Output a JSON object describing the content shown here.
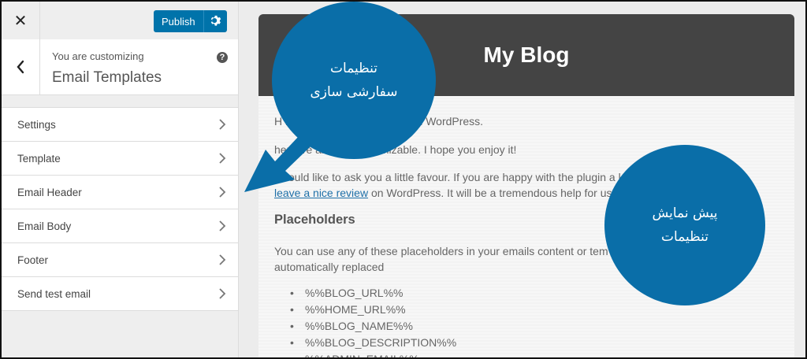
{
  "customizer": {
    "close_glyph": "✕",
    "publish_label": "Publish",
    "info_subtitle": "You are customizing",
    "info_title": "Email Templates",
    "help_glyph": "?",
    "menu": [
      {
        "label": "Settings"
      },
      {
        "label": "Template"
      },
      {
        "label": "Email Header"
      },
      {
        "label": "Email Body"
      },
      {
        "label": "Footer"
      },
      {
        "label": "Send test email"
      }
    ]
  },
  "preview": {
    "blog_title": "My Blog",
    "line1": "H                                   ntent that is normally sent in WordPress.",
    "line2": "                                 hensive an fully customizable. I hope you enjoy it!",
    "line3": "I would like to ask you a little favour. If you are happy with the plugin a               lease",
    "link_text": "leave a nice review",
    "line4_rest": " on WordPress. It will be a tremendous help for us!",
    "placeholders_heading": "Placeholders",
    "placeholders_line1": "You can use any of these placeholders in your emails content or tem",
    "placeholders_line2": "automatically replaced",
    "placeholders": [
      "%%BLOG_URL%%",
      "%%HOME_URL%%",
      "%%BLOG_NAME%%",
      "%%BLOG_DESCRIPTION%%",
      "%%ADMIN_EMAIL%%"
    ]
  },
  "annotations": {
    "bubble1_line1": "تنظیمات",
    "bubble1_line2": "سفارشی سازی",
    "bubble2_line1": "پیش نمایش",
    "bubble2_line2": "تنظیمات"
  },
  "colors": {
    "accent": "#0073aa",
    "bubble": "#0a6ea8",
    "header_bg": "#444444"
  }
}
